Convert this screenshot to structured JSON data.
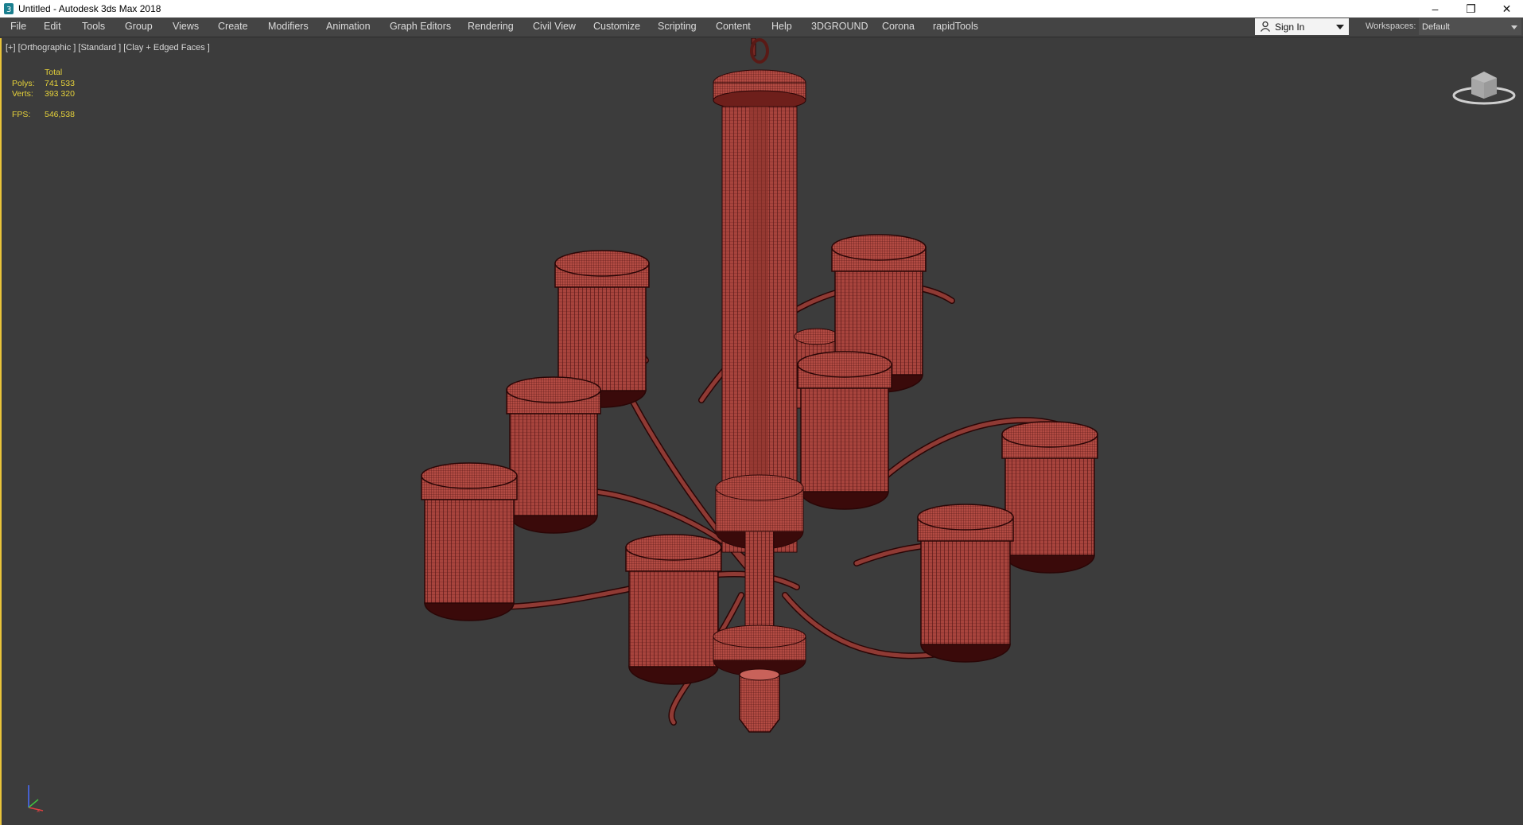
{
  "window": {
    "title": "Untitled - Autodesk 3ds Max 2018",
    "minimize": "–",
    "restore": "❐",
    "close": "✕"
  },
  "menu": {
    "file": "File",
    "edit": "Edit",
    "tools": "Tools",
    "group": "Group",
    "views": "Views",
    "create": "Create",
    "modifiers": "Modifiers",
    "animation": "Animation",
    "graph_editors": "Graph Editors",
    "rendering": "Rendering",
    "civil_view": "Civil View",
    "customize": "Customize",
    "scripting": "Scripting",
    "content": "Content",
    "help": "Help",
    "threedground": "3DGROUND",
    "corona": "Corona",
    "rapidtools": "rapidTools"
  },
  "account": {
    "signin_label": "Sign In",
    "icon": "person-icon"
  },
  "workspaces": {
    "label": "Workspaces:",
    "value": "Default"
  },
  "viewport": {
    "label": "[+] [Orthographic ] [Standard ] [Clay + Edged Faces ]",
    "stats": {
      "total_label": "Total",
      "polys_label": "Polys:",
      "polys_value": "741 533",
      "verts_label": "Verts:",
      "verts_value": "393 320",
      "fps_label": "FPS:",
      "fps_value": "546,538"
    }
  },
  "colors": {
    "viewport_bg": "#3c3c3c",
    "menubar_bg": "#444444",
    "stats_text": "#e6d23a",
    "mesh_fill": "#a8443d",
    "mesh_wire": "#3a0a0a",
    "active_border": "#e9c43a"
  }
}
